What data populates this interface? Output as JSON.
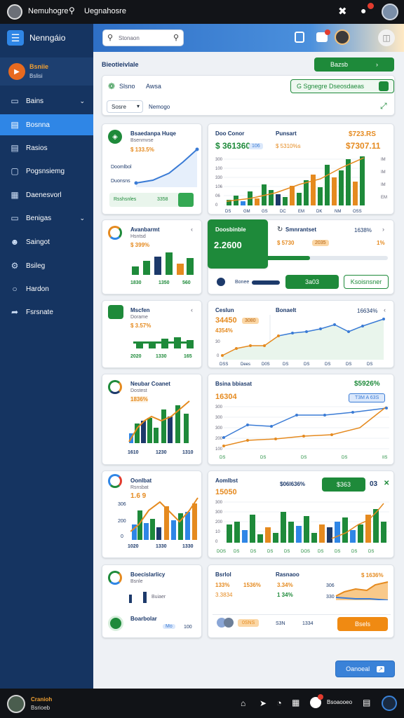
{
  "topbar": {
    "app_name": "Nemuhogre",
    "search_label": "Uegnahosre"
  },
  "header": {
    "brand": "Nenngáio",
    "search_placeholder": "Stonaon"
  },
  "sidebar": {
    "profile": {
      "name": "Bsniie",
      "sub": "Bslisi"
    },
    "items": [
      {
        "label": "Bains",
        "icon": "briefcase-icon"
      },
      {
        "label": "Bosnna",
        "icon": "chart-icon"
      },
      {
        "label": "Rasios",
        "icon": "list-icon"
      },
      {
        "label": "Pogsnsiemg",
        "icon": "box-icon"
      },
      {
        "label": "Daenesvorl",
        "icon": "calendar-icon"
      },
      {
        "label": "Benigas",
        "icon": "folder-icon"
      },
      {
        "label": "Saingot",
        "icon": "user-icon"
      },
      {
        "label": "Bsileg",
        "icon": "gear-icon"
      },
      {
        "label": "Hardon",
        "icon": "circle-icon"
      },
      {
        "label": "Fsrsnate",
        "icon": "share-icon"
      }
    ]
  },
  "toolbar": {
    "section_title": "Bieotieivlale",
    "green_action": "Bazsb",
    "tab1": "Slsno",
    "tab2": "Awsa",
    "filter_button": "G  Sgnegre Dseosdaeas",
    "select_value": "Sosre",
    "select_label": "Nemogo"
  },
  "cards": {
    "c1": {
      "title": "Bsaedanpa Huqe",
      "sub": "Bsenmvse",
      "pct": "$ 133.5%",
      "l1": "Doomlbol",
      "l2": "Duonsns",
      "foot": "Rsshsnles",
      "foot_val": "3358"
    },
    "c2": {
      "title": "Doo Conor",
      "title2": "Punsart",
      "val1": "$ 361360",
      "badge": "106",
      "val2": "$ 5310%s",
      "val3": "$723.RS",
      "val4": "$7307.11",
      "y": [
        "300",
        "100",
        "330",
        "106",
        "06",
        "0"
      ],
      "x": [
        "DS",
        "GM",
        "GS",
        "DC",
        "EM",
        "DK",
        "NM",
        "OSS"
      ],
      "r": [
        "IM",
        "IM",
        "IM",
        "EM"
      ]
    },
    "c3": {
      "title": "Avanbarmt",
      "sub": "Hsntsd",
      "pct": "$ 399%",
      "x": [
        "1830",
        "1350",
        "560"
      ]
    },
    "c4": {
      "title": "Doosbinble",
      "value": "2.2600",
      "progress": 0.55
    },
    "c5": {
      "title": "Smnrantset",
      "pct": "1638%",
      "v1": "$ 5730",
      "badge": "2035",
      "v2": "1%",
      "foot": "Bonee",
      "btn1": "3a03",
      "btn2": "Ksoisnsner"
    },
    "c6": {
      "title": "Mscfen",
      "sub": "Dorame",
      "pct": "$ 3.57%",
      "x": [
        "2020",
        "1330",
        "165"
      ]
    },
    "c7": {
      "title": "Ceslun",
      "title2": "Bonaelt",
      "pct": "16634%",
      "v1": "34450",
      "badge": "3080",
      "v2": "4354%",
      "x": [
        "DSS",
        "Dees",
        "D0S",
        "DS",
        "DS",
        "DS",
        "DS",
        "DS"
      ],
      "y": [
        "30",
        "0"
      ]
    },
    "c8": {
      "title": "Neubar Coanet",
      "sub": "Dostest",
      "pct": "1836%",
      "x": [
        "1610",
        "1230",
        "1310"
      ]
    },
    "c9": {
      "title": "Bsina bbiasat",
      "pct": "$5926%",
      "v1": "16304",
      "badge": "T3M A 63S",
      "y": [
        "300",
        "300",
        "300",
        "200",
        "100"
      ],
      "x": [
        "DS",
        "DS",
        "DS",
        "DS",
        "IIS"
      ]
    },
    "c10": {
      "title": "Oonlbat",
      "sub": "Rsnsbat",
      "pct": "1.6 9",
      "x": [
        "1020",
        "1330",
        "1330"
      ],
      "y": [
        "306",
        "200",
        "0"
      ]
    },
    "c11": {
      "title": "Aomlbst",
      "v1": "15050",
      "v2": "$06l636%",
      "btn": "$363",
      "v3": "03",
      "x": [
        "DOS",
        "DS",
        "DS",
        "DS",
        "DS",
        "DOS",
        "DS",
        "DS",
        "DS",
        "DS"
      ],
      "y": [
        "300",
        "300",
        "200",
        "10",
        "0"
      ]
    },
    "c12": {
      "title": "Boecislarlicy",
      "sub": "Bsnle",
      "l1": "Buiaer",
      "l2": "Boarbolar",
      "badge": "Mo",
      "val": "100"
    },
    "c13": {
      "title": "Bsrlol",
      "title2": "Rasnaoo",
      "pct": "$ 1636%",
      "v1": "133%",
      "v2": "1536%",
      "v3": "3.34%",
      "v4": "3.3834",
      "v5": "1 34%",
      "y": [
        "306",
        "330"
      ],
      "foot1": "0SNS",
      "foot2": "S3N",
      "foot3": "1334",
      "btn": "Bsels"
    }
  },
  "fab": {
    "label": "Oanoeal"
  },
  "bottombar": {
    "name": "Cranioh",
    "sub": "Bsrioeb",
    "item": "Bsoaooeo"
  },
  "colors": {
    "green": "#1e8a3a",
    "orange": "#e58a1f",
    "navy": "#153461",
    "blue": "#2f86e6"
  }
}
